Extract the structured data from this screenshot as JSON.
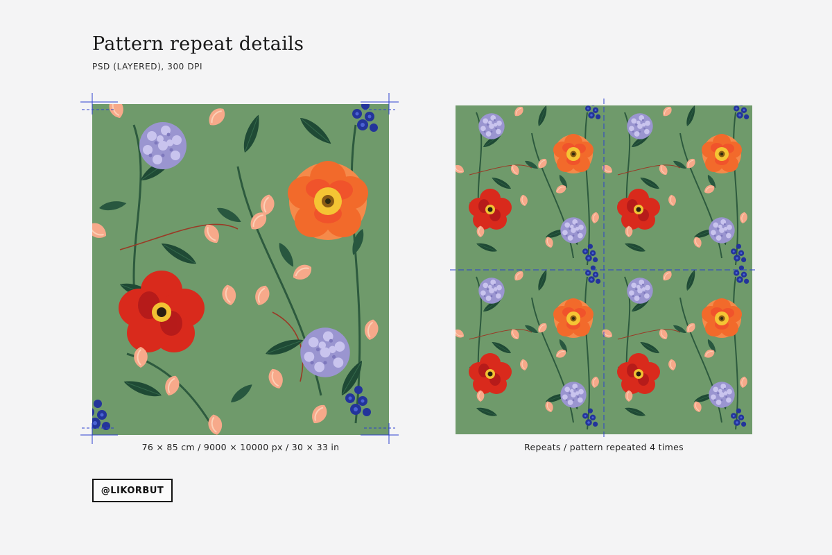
{
  "header": {
    "title": "Pattern repeat details",
    "subtitle": "PSD (LAYERED), 300 DPI"
  },
  "captions": {
    "left": "76 × 85 cm / 9000 × 10000 px / 30 × 33 in",
    "right": "Repeats / pattern repeated 4 times"
  },
  "badge": {
    "label": "@LIKORBUT"
  },
  "pattern": {
    "repeat_count": 4,
    "colors": {
      "background": "#6f9a6b",
      "leaf": "#1f4a35",
      "peony_orange": "#f26a2b",
      "poppy_red": "#d92a1c",
      "peach_petal": "#f7a98a",
      "hydrangea": "#a7a4d9",
      "delphinium": "#23349a",
      "guide_blue": "#2b3fcf"
    },
    "icons": [
      "registration-guide-mark",
      "poppy-flower",
      "peony-flower",
      "hydrangea-cluster",
      "sweet-pea-petal",
      "delphinium-sprig",
      "leaf"
    ]
  }
}
